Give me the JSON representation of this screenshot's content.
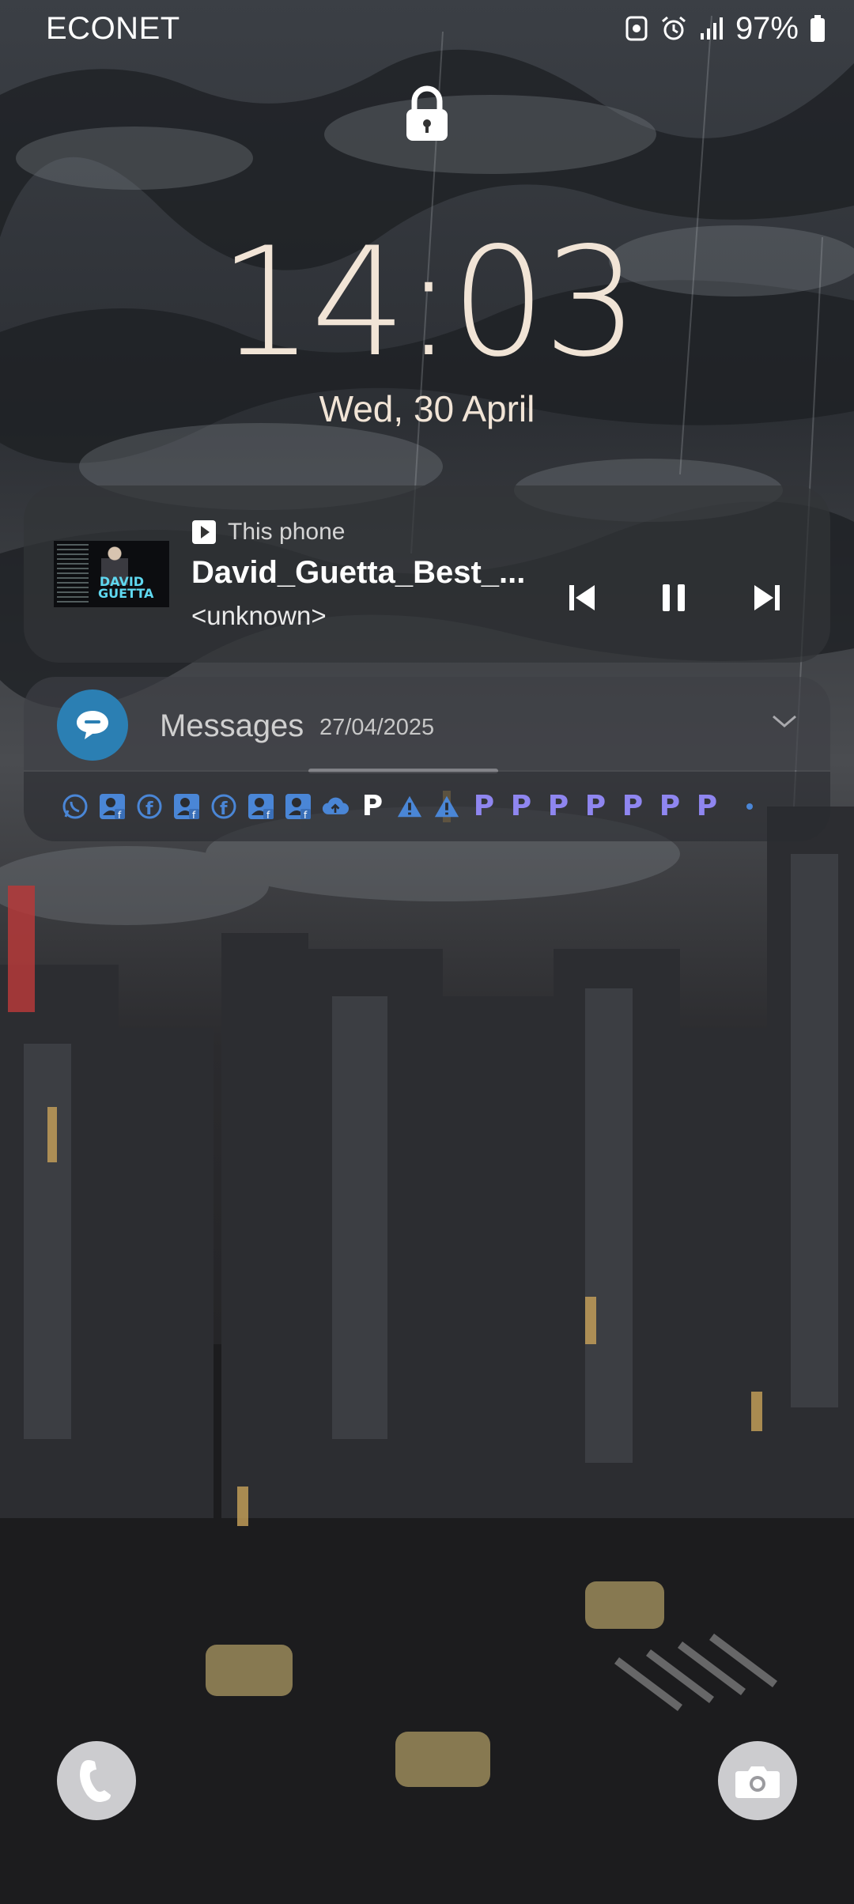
{
  "status_bar": {
    "carrier": "ECONET",
    "battery_percent": "97%",
    "icons": [
      "lock-screen-notif-icon",
      "alarm-icon",
      "signal-icon",
      "battery-icon"
    ]
  },
  "lockscreen": {
    "time": "14:03",
    "date": "Wed, 30 April",
    "lock_icon": "padlock-icon"
  },
  "media": {
    "source": "This phone",
    "title": "David_Guetta_Best_...",
    "artist": "<unknown>",
    "album_art_text": "DAVID GUETTA",
    "controls": [
      "previous-icon",
      "pause-icon",
      "next-icon"
    ]
  },
  "messages": {
    "app_name": "Messages",
    "date": "27/04/2025"
  },
  "notification_icons": [
    "whatsapp-icon",
    "facebook-contact-icon",
    "facebook-icon",
    "facebook-contact-icon",
    "facebook-icon",
    "facebook-contact-icon",
    "facebook-contact-icon",
    "cloud-icon",
    "p-app-icon",
    "warning-icon",
    "warning-icon",
    "p-app-icon",
    "p-app-icon",
    "p-app-icon",
    "p-app-icon",
    "p-app-icon",
    "p-app-icon",
    "p-app-icon",
    "more-dot-icon"
  ],
  "p_glyph": "P",
  "shortcuts": [
    "phone-icon",
    "camera-icon"
  ],
  "colors": {
    "clock": "#f1e4d6",
    "messages_icon_bg": "#2b7fb3",
    "notif_accent_blue": "#4a86d6",
    "notif_p_purple": "#8f86f0"
  }
}
